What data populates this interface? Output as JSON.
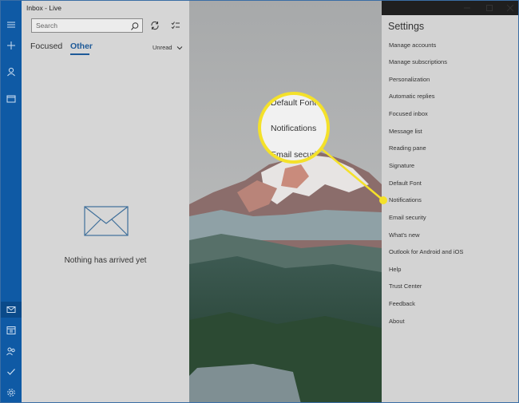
{
  "window": {
    "title": "Inbox - Live",
    "controls": [
      "minimize",
      "maximize",
      "close"
    ]
  },
  "rail": {
    "top_icons": [
      "hamburger-icon",
      "plus-icon",
      "person-icon",
      "folder-icon"
    ],
    "bottom_icons": [
      "mail-icon",
      "calendar-icon",
      "people-icon",
      "todo-icon",
      "gear-icon"
    ]
  },
  "mail_list": {
    "search_placeholder": "Search",
    "tabs": [
      {
        "label": "Focused",
        "selected": false
      },
      {
        "label": "Other",
        "selected": true
      }
    ],
    "filter_label": "Unread",
    "empty_message": "Nothing has arrived yet"
  },
  "settings": {
    "title": "Settings",
    "items": [
      "Manage accounts",
      "Manage subscriptions",
      "Personalization",
      "Automatic replies",
      "Focused inbox",
      "Message list",
      "Reading pane",
      "Signature",
      "Default Font",
      "Notifications",
      "Email security",
      "What's new",
      "Outlook for Android and iOS",
      "Help",
      "Trust Center",
      "Feedback",
      "About"
    ]
  },
  "callout": {
    "above": "Default Font",
    "focus": "Notifications",
    "below": "Email security",
    "highlight_color": "#f4e12a"
  },
  "colors": {
    "accent": "#0f5aa5",
    "tab_selected": "#1e5a98"
  }
}
